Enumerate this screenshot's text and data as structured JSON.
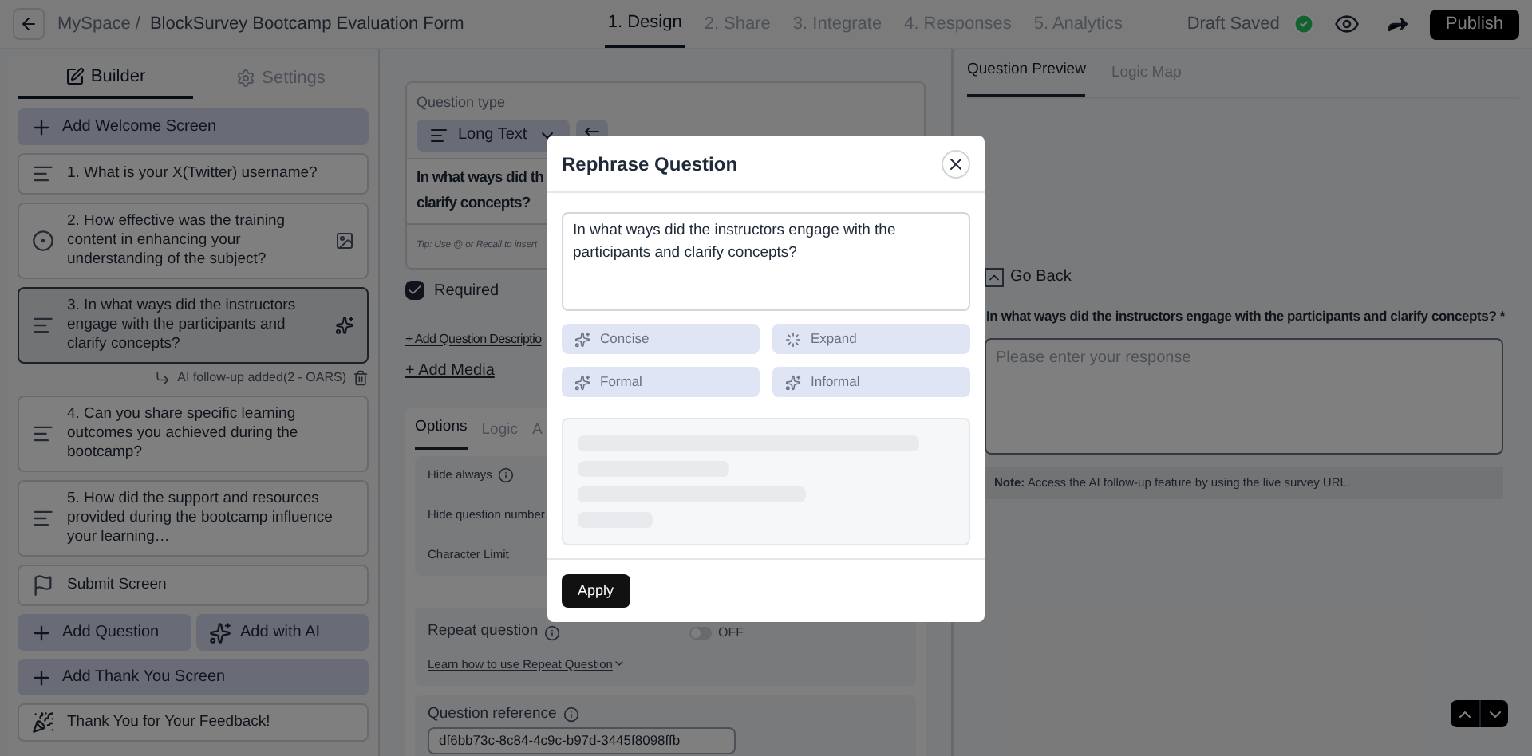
{
  "header": {
    "breadcrumb_root": "MySpace /",
    "form_title": "BlockSurvey Bootcamp Evaluation Form",
    "steps": [
      {
        "label": "1. Design",
        "selected": true
      },
      {
        "label": "2. Share",
        "selected": false
      },
      {
        "label": "3. Integrate",
        "selected": false
      },
      {
        "label": "4. Responses",
        "selected": false
      },
      {
        "label": "5. Analytics",
        "selected": false
      }
    ],
    "status": "Draft Saved",
    "publish": "Publish"
  },
  "builder": {
    "tabs": [
      {
        "label": "Builder",
        "selected": true
      },
      {
        "label": "Settings",
        "selected": false
      }
    ],
    "items": [
      {
        "kind": "add",
        "label": "Add Welcome Screen"
      },
      {
        "kind": "text",
        "label": "1. What is your X(Twitter) username?",
        "selected": false
      },
      {
        "kind": "choice",
        "label": "2. How effective was the training content in enhancing your understanding of the subject?",
        "selected": false
      },
      {
        "kind": "text",
        "label": "3. In what ways did the instructors engage with the participants and clarify concepts?",
        "selected": true,
        "note": "AI follow-up added(2 - OARS)"
      },
      {
        "kind": "text",
        "label": "4. Can you share specific learning outcomes you achieved during the bootcamp?",
        "selected": false
      },
      {
        "kind": "text",
        "label": "5. How did the support and resources provided during the bootcamp influence your learning…",
        "selected": false
      },
      {
        "kind": "submit",
        "label": "Submit Screen"
      }
    ],
    "add_question": "Add Question",
    "add_ai": "Add with AI",
    "add_thanks": "Add Thank You Screen",
    "thanks": "Thank You for Your Feedback!"
  },
  "editor": {
    "type_label": "Question type",
    "type_value": "Long Text",
    "question_lines": [
      "In what ways did th",
      "clarify concepts?"
    ],
    "tip": "Tip: Use @ or Recall to insert",
    "required": {
      "label": "Required",
      "checked": true
    },
    "add_description": "+ Add Question Descriptio",
    "add_media": "+ Add Media",
    "tabs": [
      {
        "label": "Options",
        "selected": true
      },
      {
        "label": "Logic",
        "selected": false
      },
      {
        "label": "A",
        "selected": false
      }
    ],
    "options": [
      "Hide always",
      "Hide question number",
      "Character Limit"
    ],
    "repeat": {
      "label": "Repeat question",
      "on": false,
      "state": "OFF"
    },
    "learn_link": "Learn how to use Repeat Question",
    "reference_label": "Question reference",
    "reference_value": "df6bb73c-8c84-4c9c-b97d-3445f8098ffb"
  },
  "preview": {
    "tabs": [
      {
        "label": "Question Preview",
        "selected": true
      },
      {
        "label": "Logic Map",
        "selected": false
      }
    ],
    "go_back": "Go Back",
    "question": "In what ways did the instructors engage with the participants and clarify concepts? *",
    "placeholder": "Please enter your response",
    "note_bold": "Note:",
    "note": "Access the AI follow-up feature by using the live survey URL."
  },
  "dialog": {
    "title": "Rephrase Question",
    "text": "In what ways did the instructors engage with the participants and clarify concepts?",
    "options": [
      {
        "label": "Concise",
        "loading": false
      },
      {
        "label": "Expand",
        "loading": true
      },
      {
        "label": "Formal",
        "loading": false
      },
      {
        "label": "Informal",
        "loading": false
      }
    ],
    "apply": "Apply"
  }
}
